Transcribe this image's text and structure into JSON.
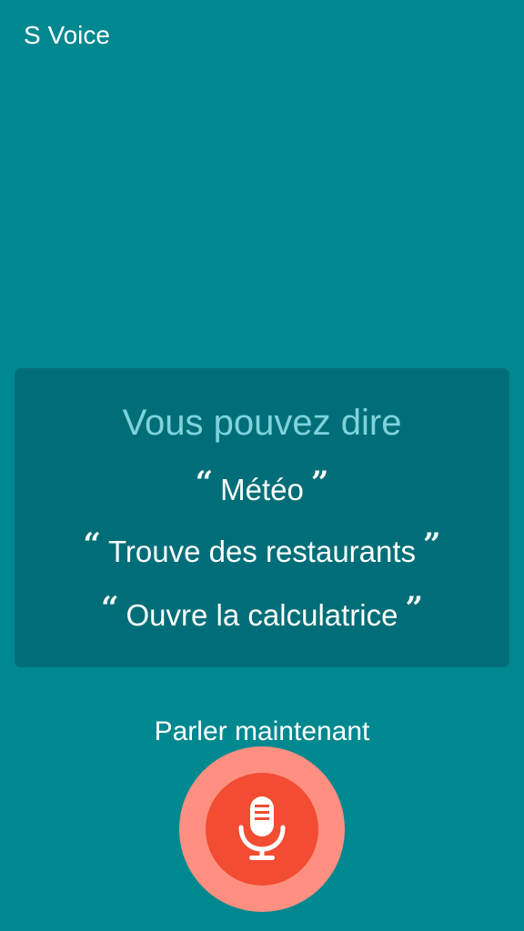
{
  "app": {
    "title": "S Voice"
  },
  "hints": {
    "heading": "Vous pouvez dire",
    "open_quote": "“",
    "close_quote": "”",
    "examples": [
      "Météo",
      "Trouve des restaurants",
      "Ouvre la calculatrice"
    ]
  },
  "voice": {
    "status": "Parler maintenant",
    "mic_icon": "microphone-icon"
  },
  "colors": {
    "background": "#008890",
    "card": "#006e78",
    "heading": "#7fd3dd",
    "mic_outer": "#ff9081",
    "mic_inner": "#f24c32"
  }
}
